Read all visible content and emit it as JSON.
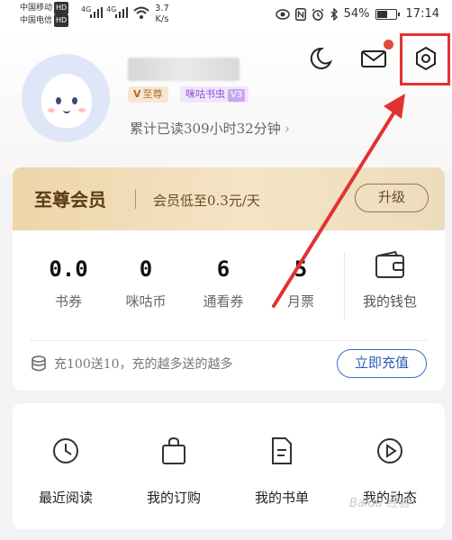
{
  "status_bar": {
    "carrier1": "中国移动",
    "carrier2": "中国电信",
    "hd1": "HD",
    "hd2": "HD",
    "net1": "4G",
    "net2": "4G",
    "speed_value": "3.7",
    "speed_unit": "K/s",
    "battery": "54%",
    "time": "17:14"
  },
  "profile": {
    "vip_badge": "至尊",
    "level_badge": "咪咕书虫",
    "level_tag": "V3",
    "read_time": "累计已读309小时32分钟",
    "chevron": "›"
  },
  "header_icons": {
    "night": "moon-icon",
    "message": "mail-icon",
    "settings": "settings-gear-icon"
  },
  "vip_card": {
    "title": "至尊会员",
    "description": "会员低至0.3元/天",
    "upgrade": "升级"
  },
  "wallet": {
    "stats": [
      {
        "value": "0.0",
        "label": "书券"
      },
      {
        "value": "0",
        "label": "咪咕币"
      },
      {
        "value": "6",
        "label": "通看券"
      },
      {
        "value": "5",
        "label": "月票"
      }
    ],
    "my_wallet": "我的钱包",
    "promo": "充100送10，充的越多送的越多",
    "recharge": "立即充值"
  },
  "features": [
    {
      "label": "最近阅读",
      "icon": "clock-icon"
    },
    {
      "label": "我的订购",
      "icon": "shopping-bag-icon"
    },
    {
      "label": "我的书单",
      "icon": "document-icon"
    },
    {
      "label": "我的动态",
      "icon": "play-circle-icon"
    }
  ],
  "watermark": "Baidu 经验",
  "colors": {
    "highlight": "#e23232",
    "vip_gold": "#eed5aa",
    "recharge_blue": "#2a5bb8",
    "notification": "#e24a3a"
  }
}
